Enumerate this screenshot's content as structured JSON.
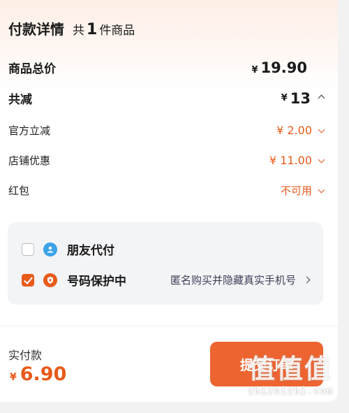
{
  "header": {
    "title": "付款详情",
    "count_prefix": "共",
    "count_value": "1",
    "count_suffix": "件商品"
  },
  "summary": {
    "total": {
      "label": "商品总价",
      "currency": "¥",
      "value": "19.90"
    },
    "discount_total": {
      "label": "共减",
      "currency": "¥",
      "value": "13",
      "expanded": true
    },
    "items": [
      {
        "label": "官方立减",
        "value": "¥ 2.00"
      },
      {
        "label": "店铺优惠",
        "value": "¥ 11.00"
      },
      {
        "label": "红包",
        "value": "不可用"
      }
    ]
  },
  "options": [
    {
      "label": "朋友代付",
      "checked": false,
      "icon": "friend-pay-icon",
      "icon_color": "#3ba3e8"
    },
    {
      "label": "号码保护中",
      "checked": true,
      "icon": "phone-shield-icon",
      "icon_color": "#e85a1a",
      "desc": "匿名购买并隐藏真实手机号"
    }
  ],
  "footer": {
    "pay_label": "实付款",
    "currency": "¥",
    "pay_amount": "6.90",
    "submit_label": "提交订单"
  },
  "watermark": {
    "logo": "值值值",
    "text": "zhizhizhi.com"
  },
  "colors": {
    "accent": "#e85a1a",
    "button": "#ed6431"
  }
}
